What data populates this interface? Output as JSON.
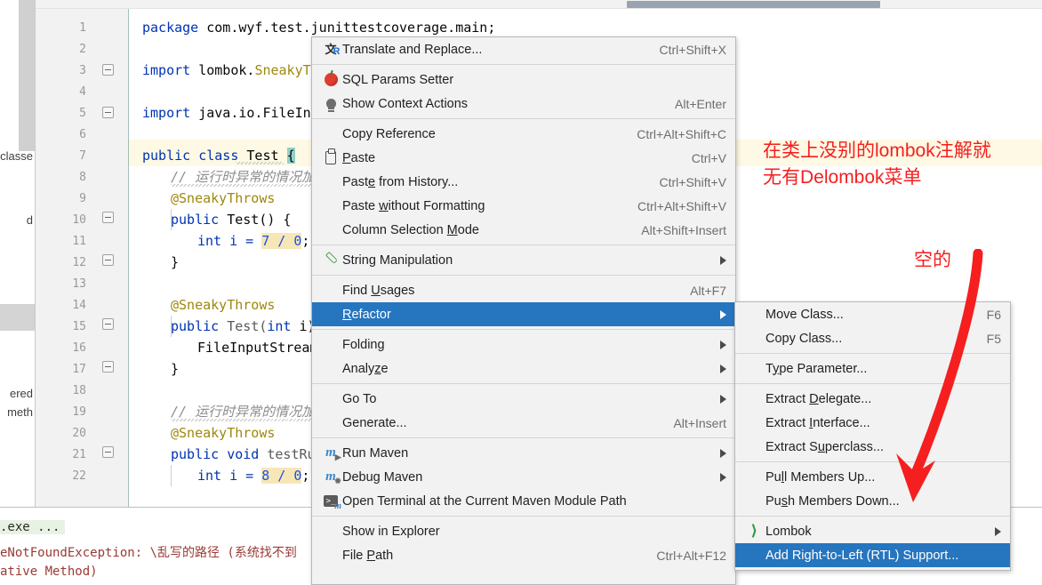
{
  "editor": {
    "line_numbers": [
      1,
      2,
      3,
      4,
      5,
      6,
      7,
      8,
      9,
      10,
      11,
      12,
      13,
      14,
      15,
      16,
      17,
      18,
      19,
      20,
      21,
      22
    ],
    "code": {
      "l1_kw": "package",
      "l1_rest": " com.wyf.test.junittestcoverage.main;",
      "l3_kw": "import",
      "l3_pkg": " lombok.",
      "l3_cls": "SneakyThrows",
      "l5_kw": "import",
      "l5_rest": " java.io.FileInputSt",
      "l7_a": "public class ",
      "l7_b": "Test",
      "l7_c": "{",
      "l8_comment": "// 运行时异常的情况加上这",
      "l9_ann": "@SneakyThrows",
      "l10_a": "public ",
      "l10_b": "Test() {",
      "l11_a": "int i = ",
      "l11_b": "7 / 0",
      "l11_c": ";",
      "l12": "}",
      "l14_ann": "@SneakyThrows",
      "l15_a": "public ",
      "l15_b": "Test(",
      "l15_c": "int",
      "l15_d": " i) {",
      "l16": "FileInputStream f",
      "l17": "}",
      "l19_comment": "// 运行时异常的情况加上这",
      "l20_ann": "@SneakyThrows",
      "l21_a": "public void ",
      "l21_b": "testRunti",
      "l22_a": "int i = ",
      "l22_b": "8 / 0",
      "l22_c": ";"
    }
  },
  "left_strip": {
    "fragments": [
      "classe",
      "d",
      "ered",
      "meth"
    ]
  },
  "console": {
    "lines": [
      ".exe ...",
      "eNotFoundException: \\乱写的路径 (系统找不到",
      "ative Method)"
    ]
  },
  "context_menu": {
    "items": [
      {
        "icon": "translate-icon",
        "label": "Translate and Replace...",
        "accel": "Ctrl+Shift+X",
        "submenu": false,
        "selected": false
      },
      {
        "separator": true
      },
      {
        "icon": "sql-params-icon",
        "label": "SQL Params Setter",
        "accel": "",
        "submenu": false,
        "selected": false
      },
      {
        "icon": "lightbulb-icon",
        "label": "Show Context Actions",
        "accel": "Alt+Enter",
        "submenu": false,
        "selected": false
      },
      {
        "separator": true
      },
      {
        "icon": "",
        "label": "Copy Reference",
        "accel": "Ctrl+Alt+Shift+C",
        "submenu": false,
        "selected": false
      },
      {
        "icon": "clipboard-icon",
        "label": "Paste",
        "accel": "Ctrl+V",
        "submenu": false,
        "selected": false,
        "mnemonic": "P"
      },
      {
        "icon": "",
        "label": "Paste from History...",
        "accel": "Ctrl+Shift+V",
        "submenu": false,
        "selected": false,
        "mnemonic": "e"
      },
      {
        "icon": "",
        "label": "Paste without Formatting",
        "accel": "Ctrl+Alt+Shift+V",
        "submenu": false,
        "selected": false,
        "mnemonic": "w"
      },
      {
        "icon": "",
        "label": "Column Selection Mode",
        "accel": "Alt+Shift+Insert",
        "submenu": false,
        "selected": false,
        "mnemonic": "M"
      },
      {
        "separator": true
      },
      {
        "icon": "pencil-icon",
        "label": "String Manipulation",
        "accel": "",
        "submenu": true,
        "selected": false
      },
      {
        "separator": true
      },
      {
        "icon": "",
        "label": "Find Usages",
        "accel": "Alt+F7",
        "submenu": false,
        "selected": false,
        "mnemonic": "U"
      },
      {
        "icon": "",
        "label": "Refactor",
        "accel": "",
        "submenu": true,
        "selected": true,
        "mnemonic": "R"
      },
      {
        "separator": true
      },
      {
        "icon": "",
        "label": "Folding",
        "accel": "",
        "submenu": true,
        "selected": false
      },
      {
        "icon": "",
        "label": "Analyze",
        "accel": "",
        "submenu": true,
        "selected": false,
        "mnemonic": "z"
      },
      {
        "separator": true
      },
      {
        "icon": "",
        "label": "Go To",
        "accel": "",
        "submenu": true,
        "selected": false
      },
      {
        "icon": "",
        "label": "Generate...",
        "accel": "Alt+Insert",
        "submenu": false,
        "selected": false
      },
      {
        "separator": true
      },
      {
        "icon": "maven-run-icon",
        "label": "Run Maven",
        "accel": "",
        "submenu": true,
        "selected": false
      },
      {
        "icon": "maven-debug-icon",
        "label": "Debug Maven",
        "accel": "",
        "submenu": true,
        "selected": false
      },
      {
        "icon": "terminal-maven-icon",
        "label": "Open Terminal at the Current Maven Module Path",
        "accel": "",
        "submenu": false,
        "selected": false
      },
      {
        "separator": true
      },
      {
        "icon": "",
        "label": "Show in Explorer",
        "accel": "",
        "submenu": false,
        "selected": false
      },
      {
        "icon": "",
        "label": "File Path",
        "accel": "Ctrl+Alt+F12",
        "submenu": false,
        "selected": false,
        "mnemonic": "P"
      }
    ]
  },
  "refactor_submenu": {
    "items": [
      {
        "label": "Move Class...",
        "accel": "F6",
        "submenu": false,
        "selected": false,
        "icon": ""
      },
      {
        "label": "Copy Class...",
        "accel": "F5",
        "submenu": false,
        "selected": false,
        "icon": ""
      },
      {
        "separator": true
      },
      {
        "label": "Type Parameter...",
        "accel": "",
        "submenu": false,
        "selected": false,
        "icon": "",
        "mnemonic": "y"
      },
      {
        "separator": true
      },
      {
        "label": "Extract Delegate...",
        "accel": "",
        "submenu": false,
        "selected": false,
        "icon": "",
        "mnemonic": "D"
      },
      {
        "label": "Extract Interface...",
        "accel": "",
        "submenu": false,
        "selected": false,
        "icon": "",
        "mnemonic": "I"
      },
      {
        "label": "Extract Superclass...",
        "accel": "",
        "submenu": false,
        "selected": false,
        "icon": "",
        "mnemonic": "u"
      },
      {
        "separator": true
      },
      {
        "label": "Pull Members Up...",
        "accel": "",
        "submenu": false,
        "selected": false,
        "icon": "",
        "mnemonic": "l"
      },
      {
        "label": "Push Members Down...",
        "accel": "",
        "submenu": false,
        "selected": false,
        "icon": "",
        "mnemonic": "s"
      },
      {
        "separator": true
      },
      {
        "label": "Lombok",
        "accel": "",
        "submenu": true,
        "selected": false,
        "icon": "lombok-icon"
      },
      {
        "label": "Add Right-to-Left (RTL) Support...",
        "accel": "",
        "submenu": false,
        "selected": true,
        "icon": ""
      }
    ]
  },
  "annotations": {
    "note_line1": "在类上没别的lombok注解就",
    "note_line2": "无有Delombok菜单",
    "note_empty": "空的",
    "arrow_color": "#f51f1f"
  },
  "colors": {
    "menu_bg": "#f2f2f2",
    "menu_border": "#b8b8b8",
    "selection_blue": "#2675bf",
    "accel_gray": "#6e6e6e",
    "annotation_red": "#f51f1f",
    "highlight_line": "#fdf9e4"
  }
}
